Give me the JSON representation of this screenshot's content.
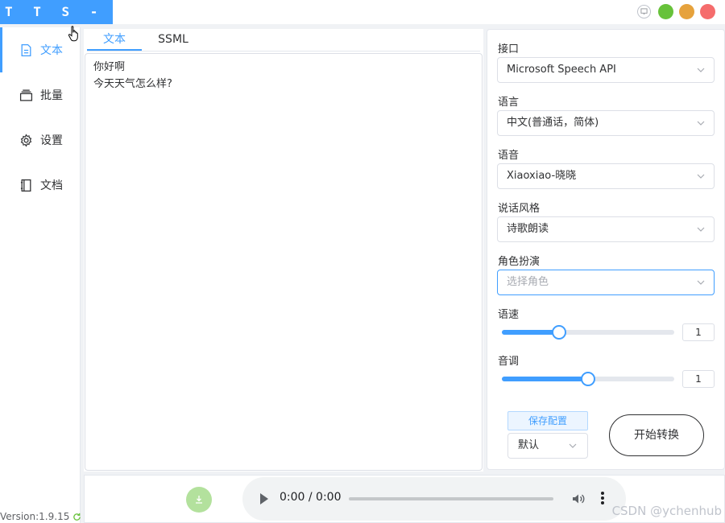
{
  "app": {
    "logo": "T T S - V U E",
    "version": "Version:1.9.15"
  },
  "colors": {
    "accent": "#409eff",
    "win_green": "#67c23a",
    "win_yellow": "#e6a23c",
    "win_red": "#f56c6c"
  },
  "sidebar": {
    "items": [
      {
        "label": "文本",
        "icon": "document-icon",
        "active": true
      },
      {
        "label": "批量",
        "icon": "stack-icon",
        "active": false
      },
      {
        "label": "设置",
        "icon": "gear-icon",
        "active": false
      },
      {
        "label": "文档",
        "icon": "book-icon",
        "active": false
      }
    ]
  },
  "editor": {
    "tabs": [
      {
        "label": "文本",
        "active": true
      },
      {
        "label": "SSML",
        "active": false
      }
    ],
    "text": "你好啊\n今天天气怎么样?"
  },
  "settings": {
    "api_label": "接口",
    "api_value": "Microsoft Speech API",
    "language_label": "语言",
    "language_value": "中文(普通话，简体)",
    "voice_label": "语音",
    "voice_value": "Xiaoxiao-晓晓",
    "style_label": "说话风格",
    "style_value": "诗歌朗读",
    "role_label": "角色扮演",
    "role_placeholder": "选择角色",
    "rate_label": "语速",
    "rate_value": "1",
    "rate_fraction": 0.33,
    "pitch_label": "音调",
    "pitch_value": "1",
    "pitch_fraction": 0.5,
    "save_label": "保存配置",
    "preset_value": "默认",
    "convert_label": "开始转换"
  },
  "player": {
    "time": "0:00 / 0:00"
  },
  "watermark": "CSDN @ychenhub"
}
